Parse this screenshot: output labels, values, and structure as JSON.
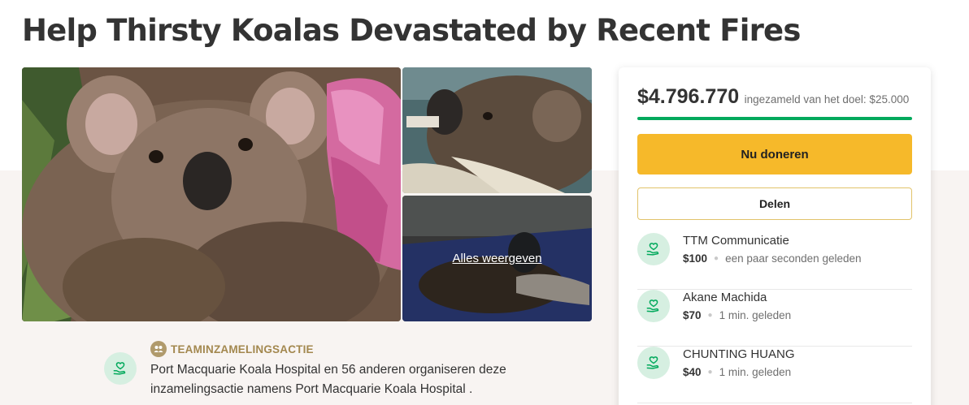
{
  "page": {
    "title": "Help Thirsty Koalas Devastated by Recent Fires"
  },
  "gallery": {
    "view_all_label": "Alles weergeven"
  },
  "organizer": {
    "team_label": "TEAMINZAMELINGSACTIE",
    "description": "Port Macquarie Koala Hospital en 56 anderen organiseren deze inzamelingsactie namens Port Macquarie Koala Hospital ."
  },
  "donation_card": {
    "amount_raised": "$4.796.770",
    "goal_text": "ingezameld van het doel: $25.000",
    "progress_fraction": 1.0,
    "donate_label": "Nu doneren",
    "share_label": "Delen",
    "donors": [
      {
        "name": "TTM Communicatie",
        "amount": "$100",
        "time": "een paar seconden geleden"
      },
      {
        "name": "Akane Machida",
        "amount": "$70",
        "time": "1 min. geleden"
      },
      {
        "name": "CHUNTING HUANG",
        "amount": "$40",
        "time": "1 min. geleden"
      }
    ]
  },
  "colors": {
    "brand_green": "#02a95c",
    "donate_button": "#f6b92a",
    "team_gold": "#a3884f",
    "avatar_bg": "#d6efe1"
  },
  "icons": {
    "donor": "heart-hand-icon",
    "team": "team-icon"
  }
}
